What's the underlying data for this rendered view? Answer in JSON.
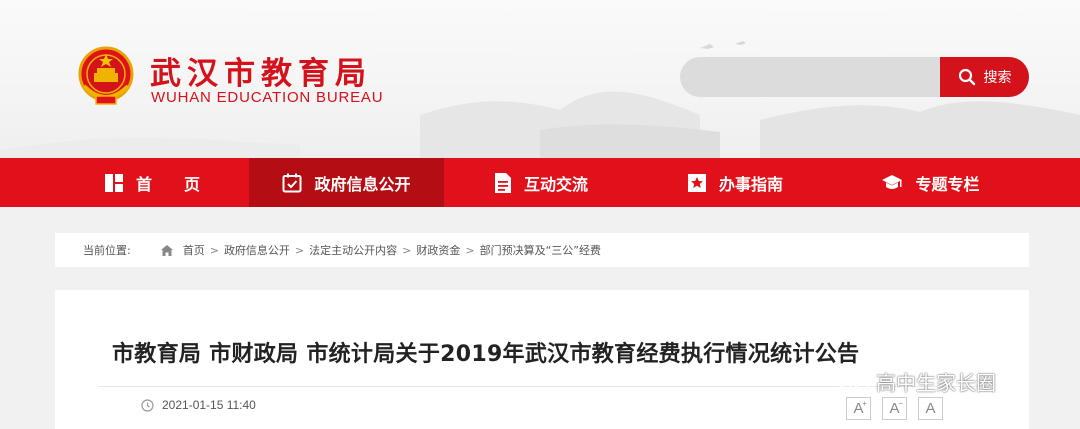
{
  "header": {
    "logo_cn": "武汉市教育局",
    "logo_en": "WUHAN EDUCATION BUREAU",
    "emblem_icon": "national-emblem-icon"
  },
  "search": {
    "placeholder": "",
    "button_label": "搜索",
    "icon": "search-icon"
  },
  "nav": {
    "items": [
      {
        "label": "首　　页",
        "icon": "home-grid-icon",
        "active": false
      },
      {
        "label": "政府信息公开",
        "icon": "calendar-check-icon",
        "active": true
      },
      {
        "label": "互动交流",
        "icon": "document-icon",
        "active": false
      },
      {
        "label": "办事指南",
        "icon": "bookmark-icon",
        "active": false
      },
      {
        "label": "专题专栏",
        "icon": "graduation-cap-icon",
        "active": false
      }
    ]
  },
  "breadcrumb": {
    "label": "当前位置:",
    "items": [
      "首页",
      "政府信息公开",
      "法定主动公开内容",
      "财政资金",
      "部门预决算及“三公”经费"
    ]
  },
  "article": {
    "title": "市教育局 市财政局 市统计局关于2019年武汉市教育经费执行情况统计公告",
    "datetime": "2021-01-15 11:40",
    "font_buttons": [
      "A",
      "A",
      "A"
    ]
  },
  "watermark": {
    "text": "高中生家长圈",
    "icon": "wechat-icon"
  },
  "colors": {
    "brand_red": "#e0111a",
    "active_red": "#b50d14",
    "logo_red": "#d3121b"
  }
}
